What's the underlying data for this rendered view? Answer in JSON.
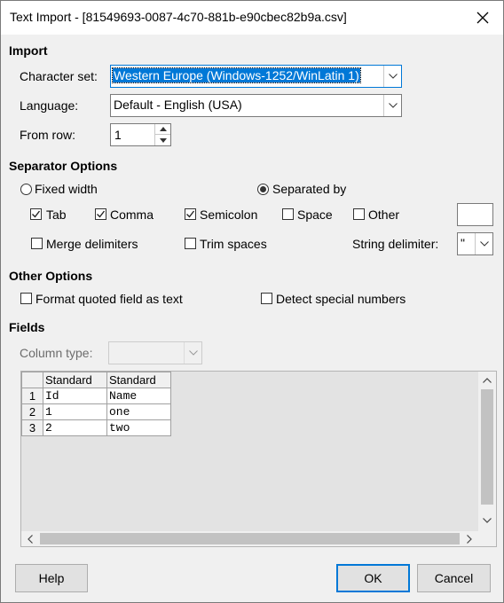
{
  "window": {
    "title": "Text Import - [81549693-0087-4c70-881b-e90cbec82b9a.csv]"
  },
  "import": {
    "heading": "Import",
    "charset": {
      "label": "Character set:",
      "value": "Western Europe (Windows-1252/WinLatin 1)"
    },
    "language": {
      "label": "Language:",
      "value": "Default - English (USA)"
    },
    "from_row": {
      "label": "From row:",
      "value": "1"
    }
  },
  "separator": {
    "heading": "Separator Options",
    "fixed_width": {
      "label": "Fixed width",
      "selected": false
    },
    "separated_by": {
      "label": "Separated by",
      "selected": true
    },
    "tab": {
      "label": "Tab",
      "checked": true
    },
    "comma": {
      "label": "Comma",
      "checked": true
    },
    "semicolon": {
      "label": "Semicolon",
      "checked": true
    },
    "space": {
      "label": "Space",
      "checked": false
    },
    "other": {
      "label": "Other",
      "checked": false,
      "value": ""
    },
    "merge_delimiters": {
      "label": "Merge delimiters",
      "checked": false
    },
    "trim_spaces": {
      "label": "Trim spaces",
      "checked": false
    },
    "string_delimiter": {
      "label": "String delimiter:",
      "value": "\""
    }
  },
  "other_options": {
    "heading": "Other Options",
    "format_quoted": {
      "label": "Format quoted field as text",
      "checked": false
    },
    "detect_special": {
      "label": "Detect special numbers",
      "checked": false
    }
  },
  "fields": {
    "heading": "Fields",
    "column_type": {
      "label": "Column type:",
      "value": ""
    },
    "columns": [
      "Standard",
      "Standard"
    ],
    "rows": [
      {
        "num": "1",
        "cells": [
          "Id",
          "Name"
        ]
      },
      {
        "num": "2",
        "cells": [
          "1",
          "one"
        ]
      },
      {
        "num": "3",
        "cells": [
          "2",
          "two"
        ]
      }
    ]
  },
  "buttons": {
    "help": "Help",
    "ok": "OK",
    "cancel": "Cancel"
  }
}
